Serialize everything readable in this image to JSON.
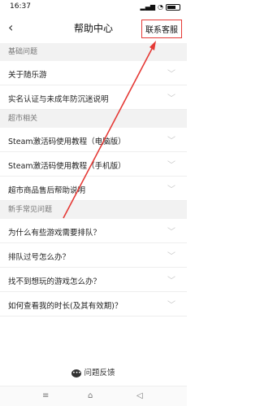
{
  "status_bar": {
    "time": "16:37",
    "battery": ""
  },
  "nav": {
    "title": "帮助中心",
    "contact_label": "联系客服"
  },
  "sections": [
    {
      "header": "基础问题",
      "items": [
        "关于随乐游",
        "实名认证与未成年防沉迷说明"
      ]
    },
    {
      "header": "超市相关",
      "items": [
        "Steam激活码使用教程（电脑版）",
        "Steam激活码使用教程（手机版）",
        "超市商品售后帮助说明"
      ]
    },
    {
      "header": "新手常见问题",
      "items": [
        "为什么有些游戏需要排队？",
        "排队过号怎么办？",
        "找不到想玩的游戏怎么办？",
        "如何查看我的时长(及其有效期)？"
      ]
    }
  ],
  "feedback": {
    "label": "问题反馈"
  },
  "icons": {
    "back": "chevron-left-icon",
    "row": "chevron-down-icon",
    "feedback": "chat-icon"
  },
  "colors": {
    "annotation": "#e53935",
    "section_bg": "#f2f2f2"
  }
}
